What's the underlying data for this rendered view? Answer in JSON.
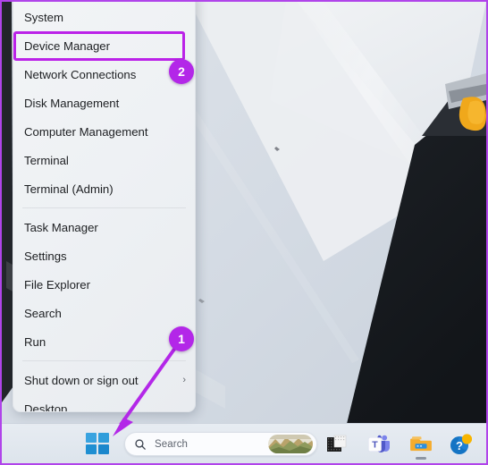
{
  "annotation": {
    "accent_color": "#b327e8",
    "highlight_color": "#bb22e8",
    "border_color": "#b044ea",
    "badges": [
      {
        "id": "badge-1",
        "label": "1",
        "points_to": "start-button"
      },
      {
        "id": "badge-2",
        "label": "2",
        "points_to": "menu-item-device-manager"
      }
    ],
    "highlighted_item": "Device Manager"
  },
  "winx_menu": {
    "name": "Win+X quick link menu",
    "items": [
      {
        "label": "System",
        "has_submenu": false
      },
      {
        "label": "Device Manager",
        "has_submenu": false,
        "highlighted": true
      },
      {
        "label": "Network Connections",
        "has_submenu": false
      },
      {
        "label": "Disk Management",
        "has_submenu": false
      },
      {
        "label": "Computer Management",
        "has_submenu": false
      },
      {
        "label": "Terminal",
        "has_submenu": false
      },
      {
        "label": "Terminal (Admin)",
        "has_submenu": false
      },
      {
        "separator_before": true,
        "label": "Task Manager",
        "has_submenu": false
      },
      {
        "label": "Settings",
        "has_submenu": false
      },
      {
        "label": "File Explorer",
        "has_submenu": false
      },
      {
        "label": "Search",
        "has_submenu": false
      },
      {
        "label": "Run",
        "has_submenu": false
      },
      {
        "separator_before": true,
        "label": "Shut down or sign out",
        "has_submenu": true,
        "chevron": "›"
      },
      {
        "label": "Desktop",
        "has_submenu": false
      }
    ]
  },
  "taskbar": {
    "start_button": {
      "name": "start-button",
      "icon": "windows-logo-icon"
    },
    "search": {
      "icon": "search-icon",
      "placeholder": "Search",
      "thumbnail": "landscape-photo-thumbnail"
    },
    "pinned": [
      {
        "name": "file-explorer-dark-icon",
        "icon": "file-explorer-icon",
        "running": false
      },
      {
        "name": "microsoft-teams-icon",
        "icon": "teams-icon",
        "running": false
      },
      {
        "name": "file-explorer-icon",
        "icon": "folder-icon",
        "running": true
      },
      {
        "name": "get-help-icon",
        "icon": "help-icon",
        "running": false
      }
    ]
  },
  "desktop": {
    "wallpaper": "abstract-geometric-light-gray-and-black",
    "colors": {
      "light_panel": "#d6dce4",
      "pale_panel": "#eef0f3",
      "dark_panel": "#15181c",
      "accent_yellow": "#f0a81b"
    }
  }
}
